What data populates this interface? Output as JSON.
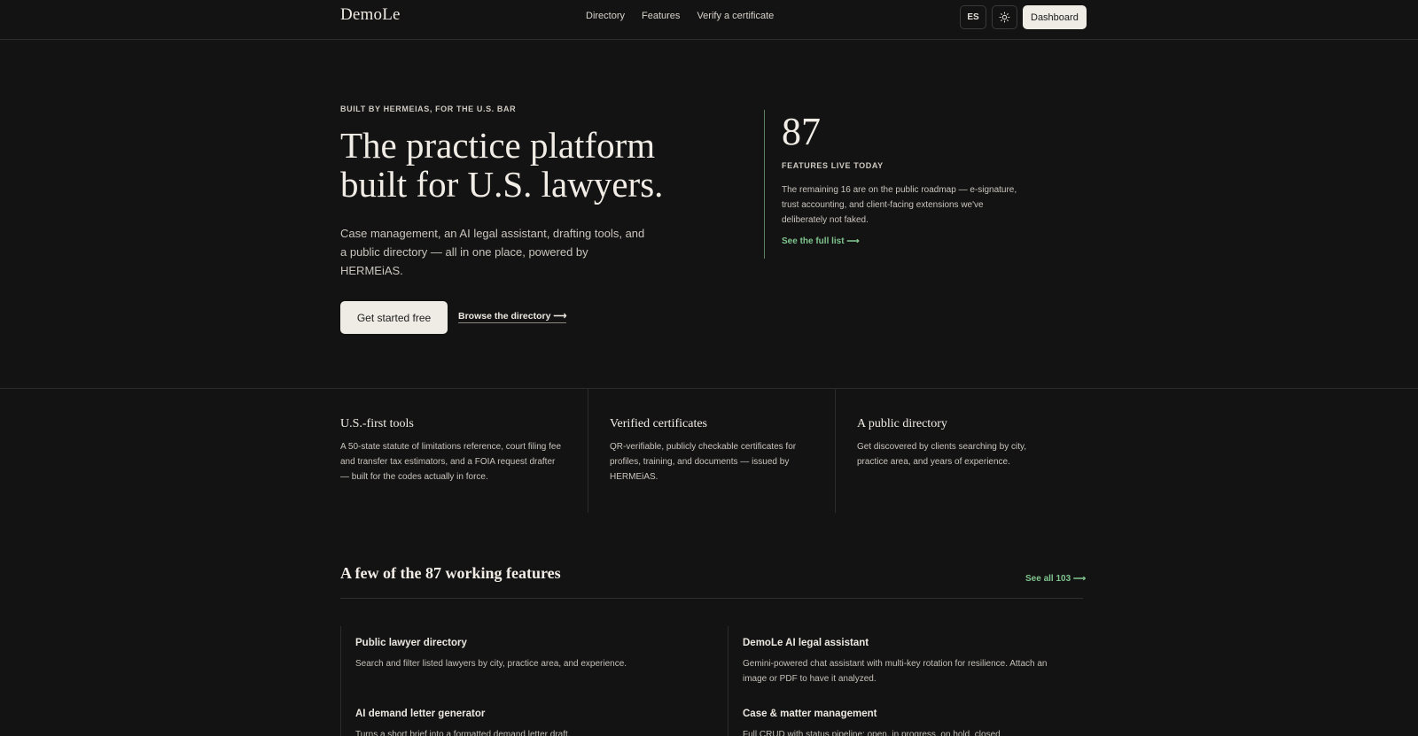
{
  "header": {
    "logo": "DemoLe",
    "nav": [
      "Directory",
      "Features",
      "Verify a certificate"
    ],
    "lang_button": "ES",
    "theme_icon": "sun-icon",
    "dashboard_label": "Dashboard"
  },
  "hero": {
    "eyebrow": "BUILT BY HERMEIAS, FOR THE U.S. BAR",
    "title": "The practice platform built for U.S. lawyers.",
    "subtitle": "Case management, an AI legal assistant, drafting tools, and a public directory — all in one place, powered by HERMEiAS.",
    "cta_primary": "Get started free",
    "cta_secondary": "Browse the directory ⟶"
  },
  "stat": {
    "number": "87",
    "label": "FEATURES LIVE TODAY",
    "description": "The remaining 16 are on the public roadmap — e-signature, trust accounting, and client-facing extensions we've deliberately not faked.",
    "link": "See the full list ⟶"
  },
  "pillars": [
    {
      "title": "U.S.-first tools",
      "text": "A 50-state statute of limitations reference, court filing fee and transfer tax estimators, and a FOIA request drafter — built for the codes actually in force."
    },
    {
      "title": "Verified certificates",
      "text": "QR-verifiable, publicly checkable certificates for profiles, training, and documents — issued by HERMEiAS."
    },
    {
      "title": "A public directory",
      "text": "Get discovered by clients searching by city, practice area, and years of experience."
    }
  ],
  "features": {
    "title": "A few of the 87 working features",
    "see_all": "See all 103 ⟶",
    "items": [
      {
        "title": "Public lawyer directory",
        "text": "Search and filter listed lawyers by city, practice area, and experience."
      },
      {
        "title": "DemoLe AI legal assistant",
        "text": "Gemini-powered chat assistant with multi-key rotation for resilience. Attach an image or PDF to have it analyzed."
      },
      {
        "title": "AI demand letter generator",
        "text": "Turns a short brief into a formatted demand letter draft."
      },
      {
        "title": "Case & matter management",
        "text": "Full CRUD with status pipeline: open, in progress, on hold, closed."
      }
    ]
  }
}
